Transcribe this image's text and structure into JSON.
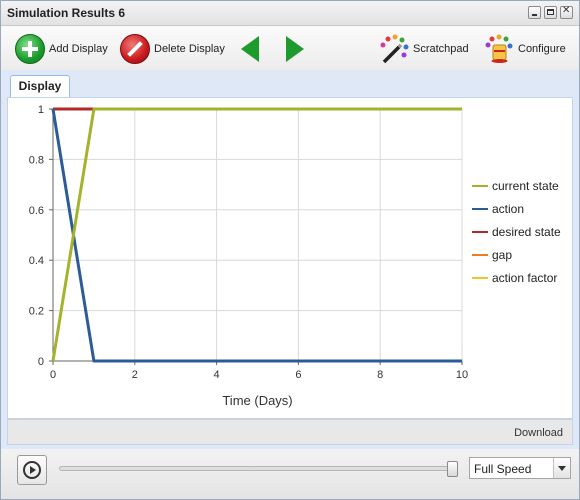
{
  "window": {
    "title": "Simulation Results 6"
  },
  "toolbar": {
    "add_label": "Add Display",
    "delete_label": "Delete Display",
    "scratchpad_label": "Scratchpad",
    "configure_label": "Configure"
  },
  "tabs": [
    {
      "label": "Display"
    }
  ],
  "footer": {
    "download_label": "Download"
  },
  "playback": {
    "speed": "Full Speed",
    "slider_level": 1.0
  },
  "colors": {
    "current_state": "#a3b42a",
    "action": "#2b5c99",
    "desired_state": "#b22a2a",
    "gap": "#ee7a22",
    "action_factor": "#f0c330"
  },
  "chart_data": {
    "type": "line",
    "xlabel": "Time (Days)",
    "ylabel": "",
    "xlim": [
      0,
      10
    ],
    "ylim": [
      0,
      1
    ],
    "x_ticks": [
      "0",
      "2",
      "4",
      "6",
      "8",
      "10"
    ],
    "y_ticks": [
      "0",
      "0.2",
      "0.4",
      "0.6",
      "0.8",
      "1"
    ],
    "grid": true,
    "legend_position": "right",
    "series": [
      {
        "name": "current state",
        "color": "#a3b42a",
        "x": [
          0,
          1,
          10
        ],
        "y": [
          0,
          1,
          1
        ]
      },
      {
        "name": "action",
        "color": "#2b5c99",
        "x": [
          0,
          1,
          10
        ],
        "y": [
          1,
          0,
          0
        ]
      },
      {
        "name": "desired state",
        "color": "#b22a2a",
        "x": [
          0,
          1
        ],
        "y": [
          1,
          1
        ]
      },
      {
        "name": "gap",
        "color": "#ee7a22",
        "x": [],
        "y": []
      },
      {
        "name": "action factor",
        "color": "#f0c330",
        "x": [],
        "y": []
      }
    ]
  }
}
